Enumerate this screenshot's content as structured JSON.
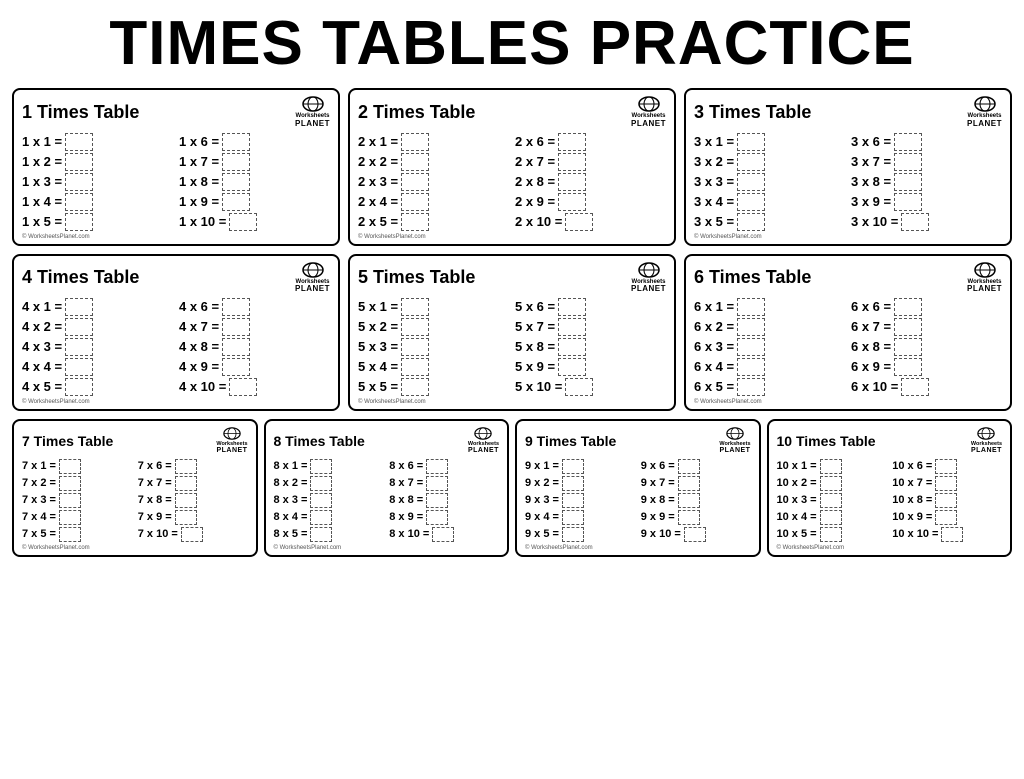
{
  "page": {
    "title": "TIMES TABLES PRACTICE",
    "brand": {
      "line1": "Worksheets",
      "line2": "PLANET",
      "footer": "© WorksheetsPlanet.com"
    }
  },
  "tables": [
    {
      "id": 1,
      "title": "1 Times Table",
      "col1": [
        "1 x 1 =",
        "1 x 2 =",
        "1 x 3 =",
        "1 x 4 =",
        "1 x 5 ="
      ],
      "col2": [
        "1 x 6 =",
        "1 x 7 =",
        "1 x 8 =",
        "1 x 9 =",
        "1 x 10 ="
      ]
    },
    {
      "id": 2,
      "title": "2 Times Table",
      "col1": [
        "2 x 1 =",
        "2 x 2 =",
        "2 x 3 =",
        "2 x 4 =",
        "2 x 5 ="
      ],
      "col2": [
        "2 x 6 =",
        "2 x 7 =",
        "2 x 8 =",
        "2 x 9 =",
        "2 x 10 ="
      ]
    },
    {
      "id": 3,
      "title": "3 Times Table",
      "col1": [
        "3 x 1 =",
        "3 x 2 =",
        "3 x 3 =",
        "3 x 4 =",
        "3 x 5 ="
      ],
      "col2": [
        "3 x 6 =",
        "3 x 7 =",
        "3 x 8 =",
        "3 x 9 =",
        "3 x 10 ="
      ]
    },
    {
      "id": 4,
      "title": "4 Times Table",
      "col1": [
        "4 x 1 =",
        "4 x 2 =",
        "4 x 3 =",
        "4 x 4 =",
        "4 x 5 ="
      ],
      "col2": [
        "4 x 6 =",
        "4 x 7 =",
        "4 x 8 =",
        "4 x 9 =",
        "4 x 10 ="
      ]
    },
    {
      "id": 5,
      "title": "5 Times Table",
      "col1": [
        "5 x 1 =",
        "5 x 2 =",
        "5 x 3 =",
        "5 x 4 =",
        "5 x 5 ="
      ],
      "col2": [
        "5 x 6 =",
        "5 x 7 =",
        "5 x 8 =",
        "5 x 9 =",
        "5 x 10 ="
      ]
    },
    {
      "id": 6,
      "title": "6 Times Table",
      "col1": [
        "6 x 1 =",
        "6 x 2 =",
        "6 x 3 =",
        "6 x 4 =",
        "6 x 5 ="
      ],
      "col2": [
        "6 x 6 =",
        "6 x 7 =",
        "6 x 8 =",
        "6 x 9 =",
        "6 x 10 ="
      ]
    },
    {
      "id": 7,
      "title": "7 Times Table",
      "col1": [
        "7 x 1 =",
        "7 x 2 =",
        "7 x 3 =",
        "7 x 4 =",
        "7 x 5 ="
      ],
      "col2": [
        "7 x 6 =",
        "7 x 7 =",
        "7 x 8 =",
        "7 x 9 =",
        "7 x 10 ="
      ]
    },
    {
      "id": 8,
      "title": "8 Times Table",
      "col1": [
        "8 x 1 =",
        "8 x 2 =",
        "8 x 3 =",
        "8 x 4 =",
        "8 x 5 ="
      ],
      "col2": [
        "8 x 6 =",
        "8 x 7 =",
        "8 x 8 =",
        "8 x 9 =",
        "8 x 10 ="
      ]
    },
    {
      "id": 9,
      "title": "9 Times Table",
      "col1": [
        "9 x 1 =",
        "9 x 2 =",
        "9 x 3 =",
        "9 x 4 =",
        "9 x 5 ="
      ],
      "col2": [
        "9 x 6 =",
        "9 x 7 =",
        "9 x 8 =",
        "9 x 9 =",
        "9 x 10 ="
      ]
    },
    {
      "id": 10,
      "title": "10 Times Table",
      "col1": [
        "10 x 1 =",
        "10 x 2 =",
        "10 x 3 =",
        "10 x 4 =",
        "10 x 5 ="
      ],
      "col2": [
        "10 x 6 =",
        "10 x 7 =",
        "10 x 8 =",
        "10 x 9 =",
        "10 x 10 ="
      ]
    }
  ]
}
